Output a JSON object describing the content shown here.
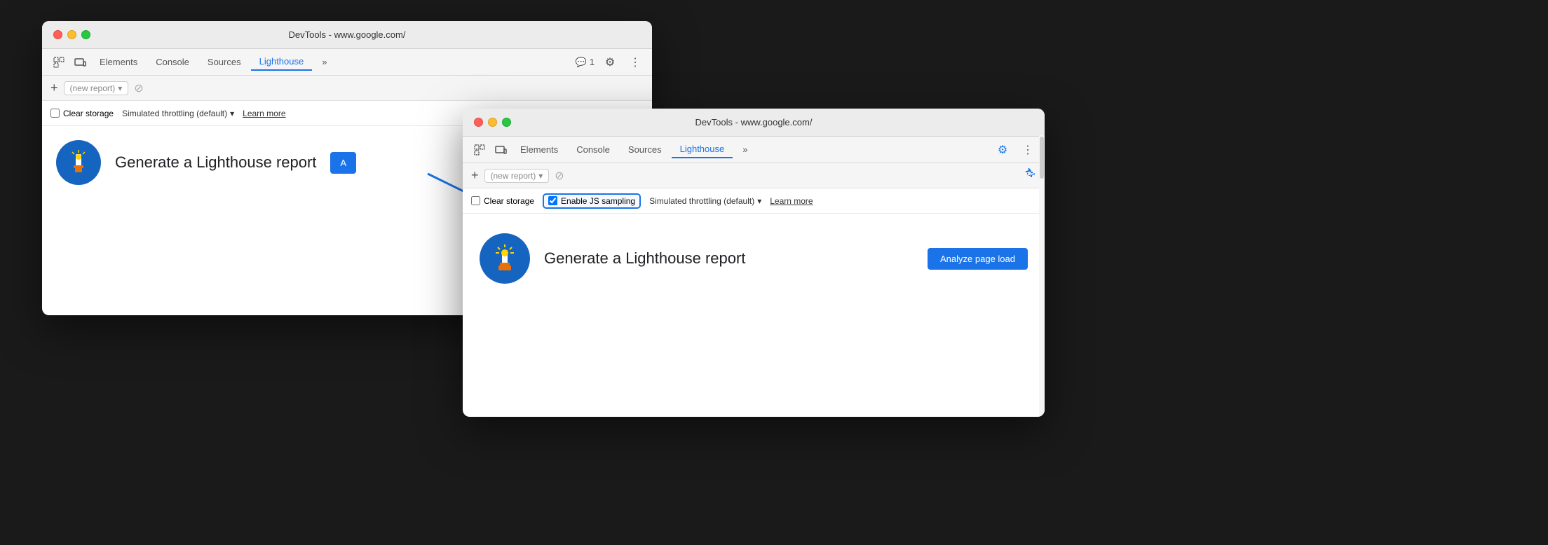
{
  "window1": {
    "title": "DevTools - www.google.com/",
    "tabs": [
      {
        "label": "Elements",
        "active": false
      },
      {
        "label": "Console",
        "active": false
      },
      {
        "label": "Sources",
        "active": false
      },
      {
        "label": "Lighthouse",
        "active": true
      },
      {
        "label": "»",
        "active": false
      }
    ],
    "toolbar": {
      "plus": "+",
      "report_placeholder": "(new report)",
      "dropdown_icon": "▾",
      "disabled_icon": "⊘"
    },
    "options": {
      "clear_storage_label": "Clear storage",
      "throttling_label": "Simulated throttling (default)",
      "throttling_dropdown": "▾",
      "learn_more": "Learn more"
    },
    "main": {
      "generate_title": "Generate a Lighthouse report",
      "analyze_btn": "A"
    }
  },
  "window2": {
    "title": "DevTools - www.google.com/",
    "tabs": [
      {
        "label": "Elements",
        "active": false
      },
      {
        "label": "Console",
        "active": false
      },
      {
        "label": "Sources",
        "active": false
      },
      {
        "label": "Lighthouse",
        "active": true
      },
      {
        "label": "»",
        "active": false
      }
    ],
    "toolbar": {
      "plus": "+",
      "report_placeholder": "(new report)",
      "dropdown_icon": "▾",
      "disabled_icon": "⊘"
    },
    "options": {
      "clear_storage_label": "Clear storage",
      "js_sampling_label": "Enable JS sampling",
      "throttling_label": "Simulated throttling (default)",
      "throttling_dropdown": "▾",
      "learn_more": "Learn more"
    },
    "main": {
      "generate_title": "Generate a Lighthouse report",
      "analyze_btn": "Analyze page load"
    }
  },
  "icons": {
    "cursor": "⊹",
    "responsive": "⊟",
    "chat_badge": "💬 1",
    "gear": "⚙",
    "more": "⋮",
    "plus": "+",
    "chevron_down": "▾",
    "prohibited": "⊘",
    "gear_blue": "⚙"
  },
  "colors": {
    "active_tab": "#1a73e8",
    "analyze_btn": "#1a73e8",
    "logo_bg": "#1565c0",
    "arrow": "#1a73e8",
    "highlight_border": "#1a73e8"
  }
}
